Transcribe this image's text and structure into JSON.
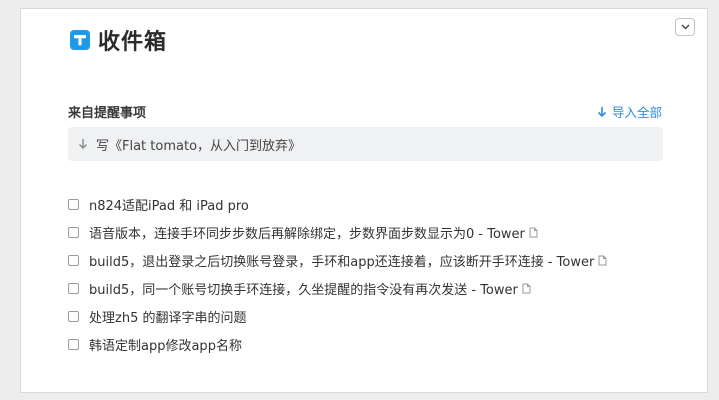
{
  "header": {
    "title": "收件箱",
    "logo_icon": "tower-logo-icon"
  },
  "corner": {
    "icon": "chevron-down-icon"
  },
  "reminders": {
    "section_title": "来自提醒事项",
    "import_label": "导入全部",
    "item_text": "写《Flat tomato，从入门到放弃》"
  },
  "todos": [
    {
      "text": "n824适配iPad 和 iPad pro",
      "has_link_icon": false
    },
    {
      "text": "语音版本，连接手环同步步数后再解除绑定，步数界面步数显示为0 - Tower",
      "has_link_icon": true
    },
    {
      "text": "build5，退出登录之后切换账号登录，手环和app还连接着，应该断开手环连接 - Tower",
      "has_link_icon": true
    },
    {
      "text": "build5，同一个账号切换手环连接，久坐提醒的指令没有再次发送 - Tower",
      "has_link_icon": true
    },
    {
      "text": "处理zh5 的翻译字串的问题",
      "has_link_icon": false
    },
    {
      "text": "韩语定制app修改app名称",
      "has_link_icon": false
    }
  ],
  "colors": {
    "accent": "#2f8ae0",
    "logo": "#1e9be8",
    "background": "#ededed",
    "reminder_bg": "#f0f1f3"
  }
}
